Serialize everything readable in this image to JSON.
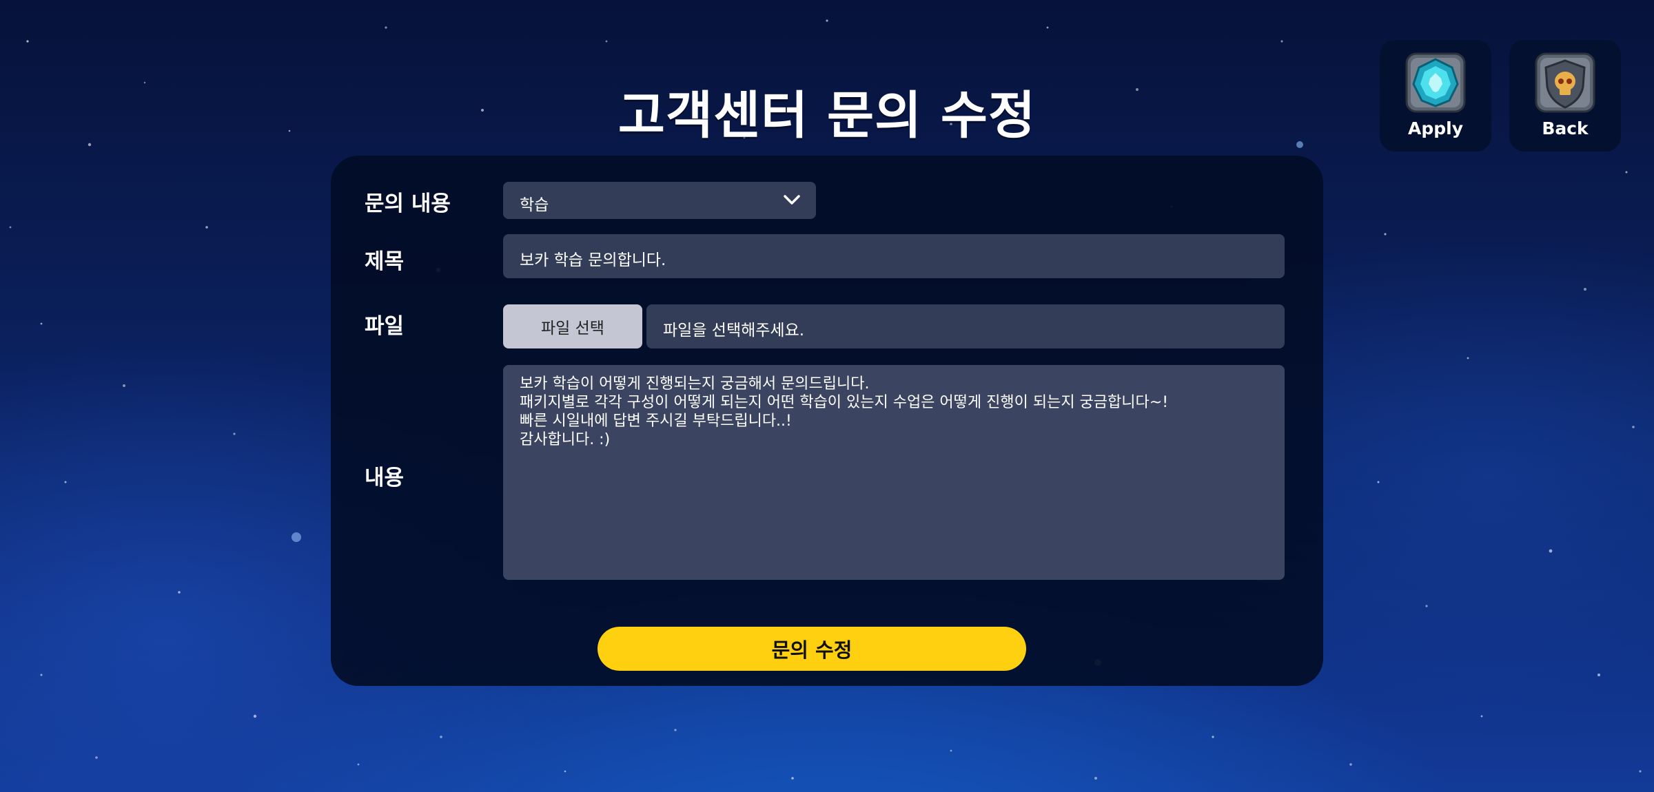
{
  "page": {
    "title": "고객센터 문의 수정"
  },
  "actions": {
    "apply_label": "Apply",
    "apply_icon": "teal-gem-icon",
    "back_label": "Back",
    "back_icon": "skull-shield-icon"
  },
  "form": {
    "inquiry_type": {
      "label": "문의 내용",
      "selected": "학습"
    },
    "subject": {
      "label": "제목",
      "value": "보카 학습 문의합니다."
    },
    "file": {
      "label": "파일",
      "button_label": "파일 선택",
      "placeholder": "파일을 선택해주세요."
    },
    "content": {
      "label": "내용",
      "value": "보카 학습이 어떻게 진행되는지 궁금해서 문의드립니다.\n패키지별로 각각 구성이 어떻게 되는지 어떤 학습이 있는지 수업은 어떻게 진행이 되는지 궁금합니다~!\n빠른 시일내에 답변 주시길 부탁드립니다..!\n감사합니다. :)"
    },
    "submit_label": "문의 수정"
  },
  "colors": {
    "panel": "#020c26",
    "field": "#343d58",
    "file_button": "#c4c6d3",
    "submit": "#ffd010",
    "apply_gem": "#3ac6d8",
    "back_skull": "#e0a63a"
  }
}
